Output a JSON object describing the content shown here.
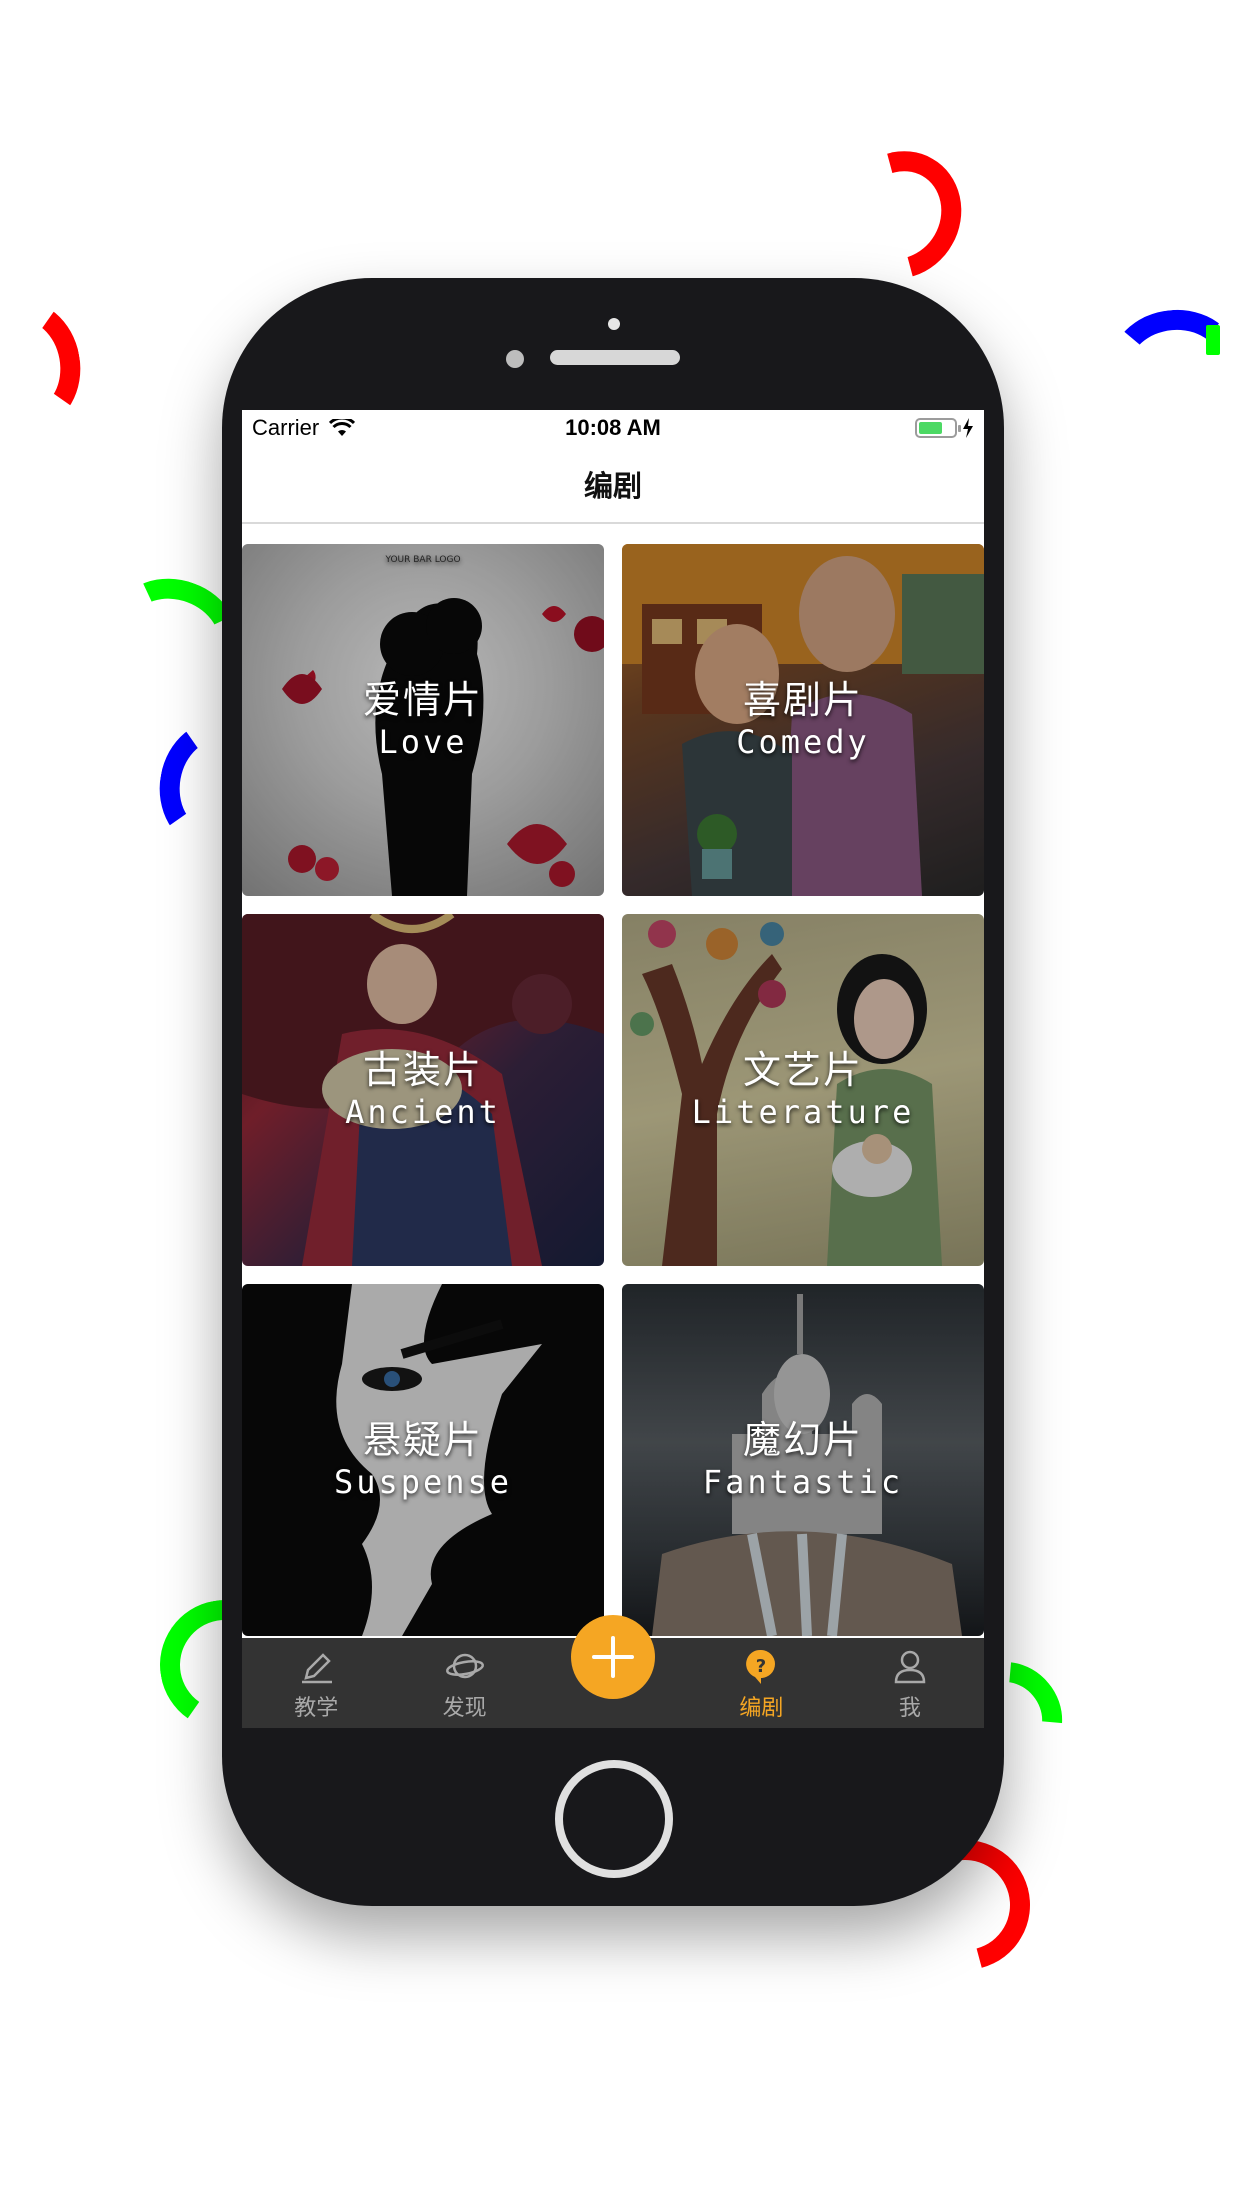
{
  "status_bar": {
    "carrier": "Carrier",
    "time": "10:08 AM",
    "battery_level": 0.68
  },
  "nav": {
    "title": "编剧"
  },
  "categories": [
    {
      "cn": "爱情片",
      "en": "Love",
      "logo_text": "YOUR BAR LOGO"
    },
    {
      "cn": "喜剧片",
      "en": "Comedy"
    },
    {
      "cn": "古装片",
      "en": "Ancient"
    },
    {
      "cn": "文艺片",
      "en": "Literature"
    },
    {
      "cn": "悬疑片",
      "en": "Suspense"
    },
    {
      "cn": "魔幻片",
      "en": "Fantastic"
    }
  ],
  "tabs": [
    {
      "label": "教学",
      "icon": "pencil-icon",
      "active": false
    },
    {
      "label": "发现",
      "icon": "planet-icon",
      "active": false
    },
    {
      "label": "",
      "icon": "plus-icon",
      "active": false
    },
    {
      "label": "编剧",
      "icon": "question-icon",
      "active": true
    },
    {
      "label": "我",
      "icon": "person-icon",
      "active": false
    }
  ],
  "colors": {
    "accent": "#f5a623",
    "tab_bar": "#333333",
    "phone_body": "#18181b"
  }
}
